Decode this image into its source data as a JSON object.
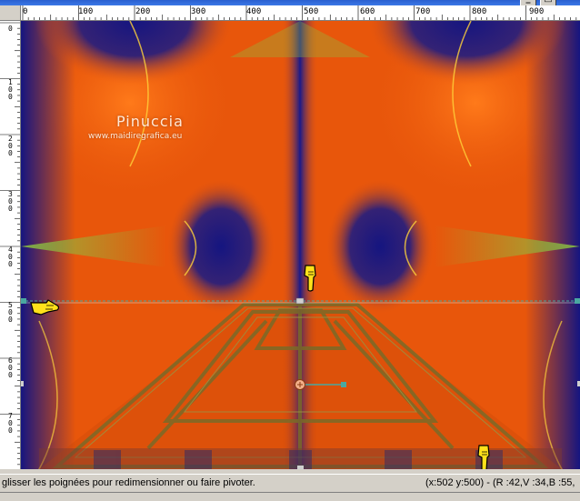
{
  "watermark": {
    "title": "Pinuccia",
    "url": "www.maidiregrafica.eu"
  },
  "ruler": {
    "horizontal_labels": [
      "0",
      "100",
      "200",
      "300",
      "400",
      "500",
      "600",
      "700",
      "800",
      "900"
    ],
    "vertical_labels": [
      "0",
      "100",
      "200",
      "300",
      "400",
      "500",
      "600",
      "700"
    ]
  },
  "status": {
    "hint": "glisser les poignées pour redimensionner ou faire pivoter.",
    "info": "(x:502 y:500) - (R :42,V :34,B :55,"
  },
  "window_buttons": [
    "_",
    "□"
  ],
  "colors": {
    "orange": "#e8560b",
    "navy": "#151580",
    "lime": "#8cc040",
    "handle_line": "#4aa8a0"
  },
  "icons": [
    "pointing-hand-down-icon",
    "pointing-hand-right-icon",
    "rotation-handle-icon"
  ]
}
